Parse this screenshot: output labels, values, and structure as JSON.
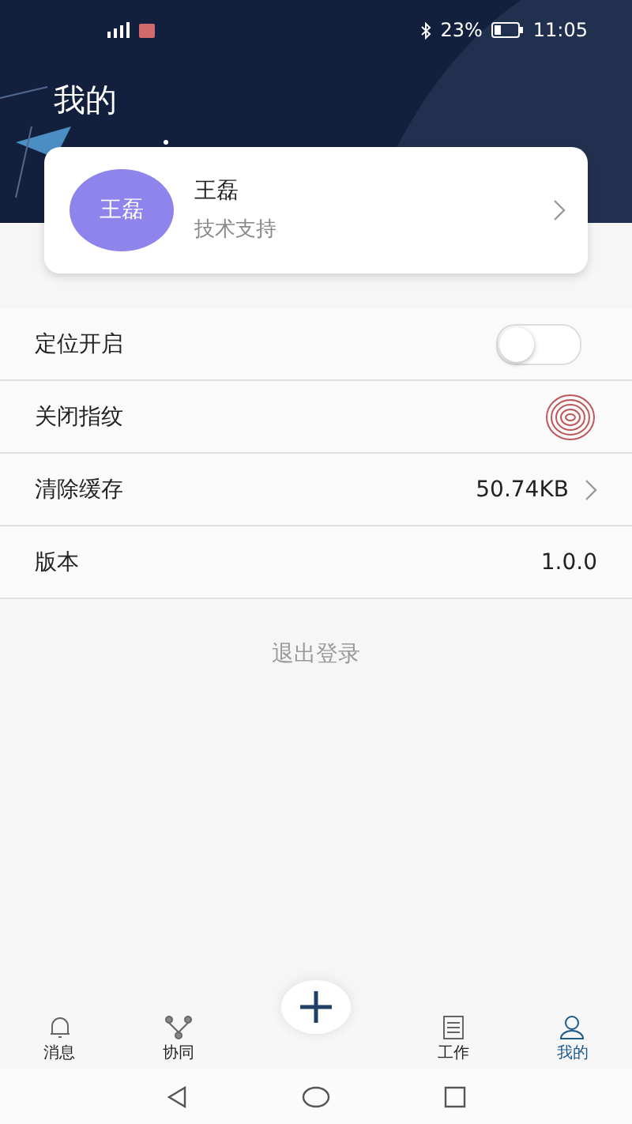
{
  "status_bar": {
    "battery": "23%",
    "time": "11:05"
  },
  "header": {
    "title": "我的"
  },
  "profile": {
    "avatar_text": "王磊",
    "name": "王磊",
    "role": "技术支持"
  },
  "settings": [
    {
      "kind": "toggle",
      "label": "定位开启",
      "on": false
    },
    {
      "kind": "fingerprint",
      "label": "关闭指纹"
    },
    {
      "kind": "link",
      "label": "清除缓存",
      "value": "50.74KB"
    },
    {
      "kind": "value",
      "label": "版本",
      "value": "1.0.0"
    }
  ],
  "logout": "退出登录",
  "tab_bar": [
    {
      "kind": "bell",
      "label": "消息",
      "selected": false
    },
    {
      "kind": "share",
      "label": "协同",
      "selected": false
    },
    {
      "kind": "plus"
    },
    {
      "kind": "list",
      "label": "工作",
      "selected": false
    },
    {
      "kind": "person",
      "label": "我的",
      "selected": true
    }
  ]
}
